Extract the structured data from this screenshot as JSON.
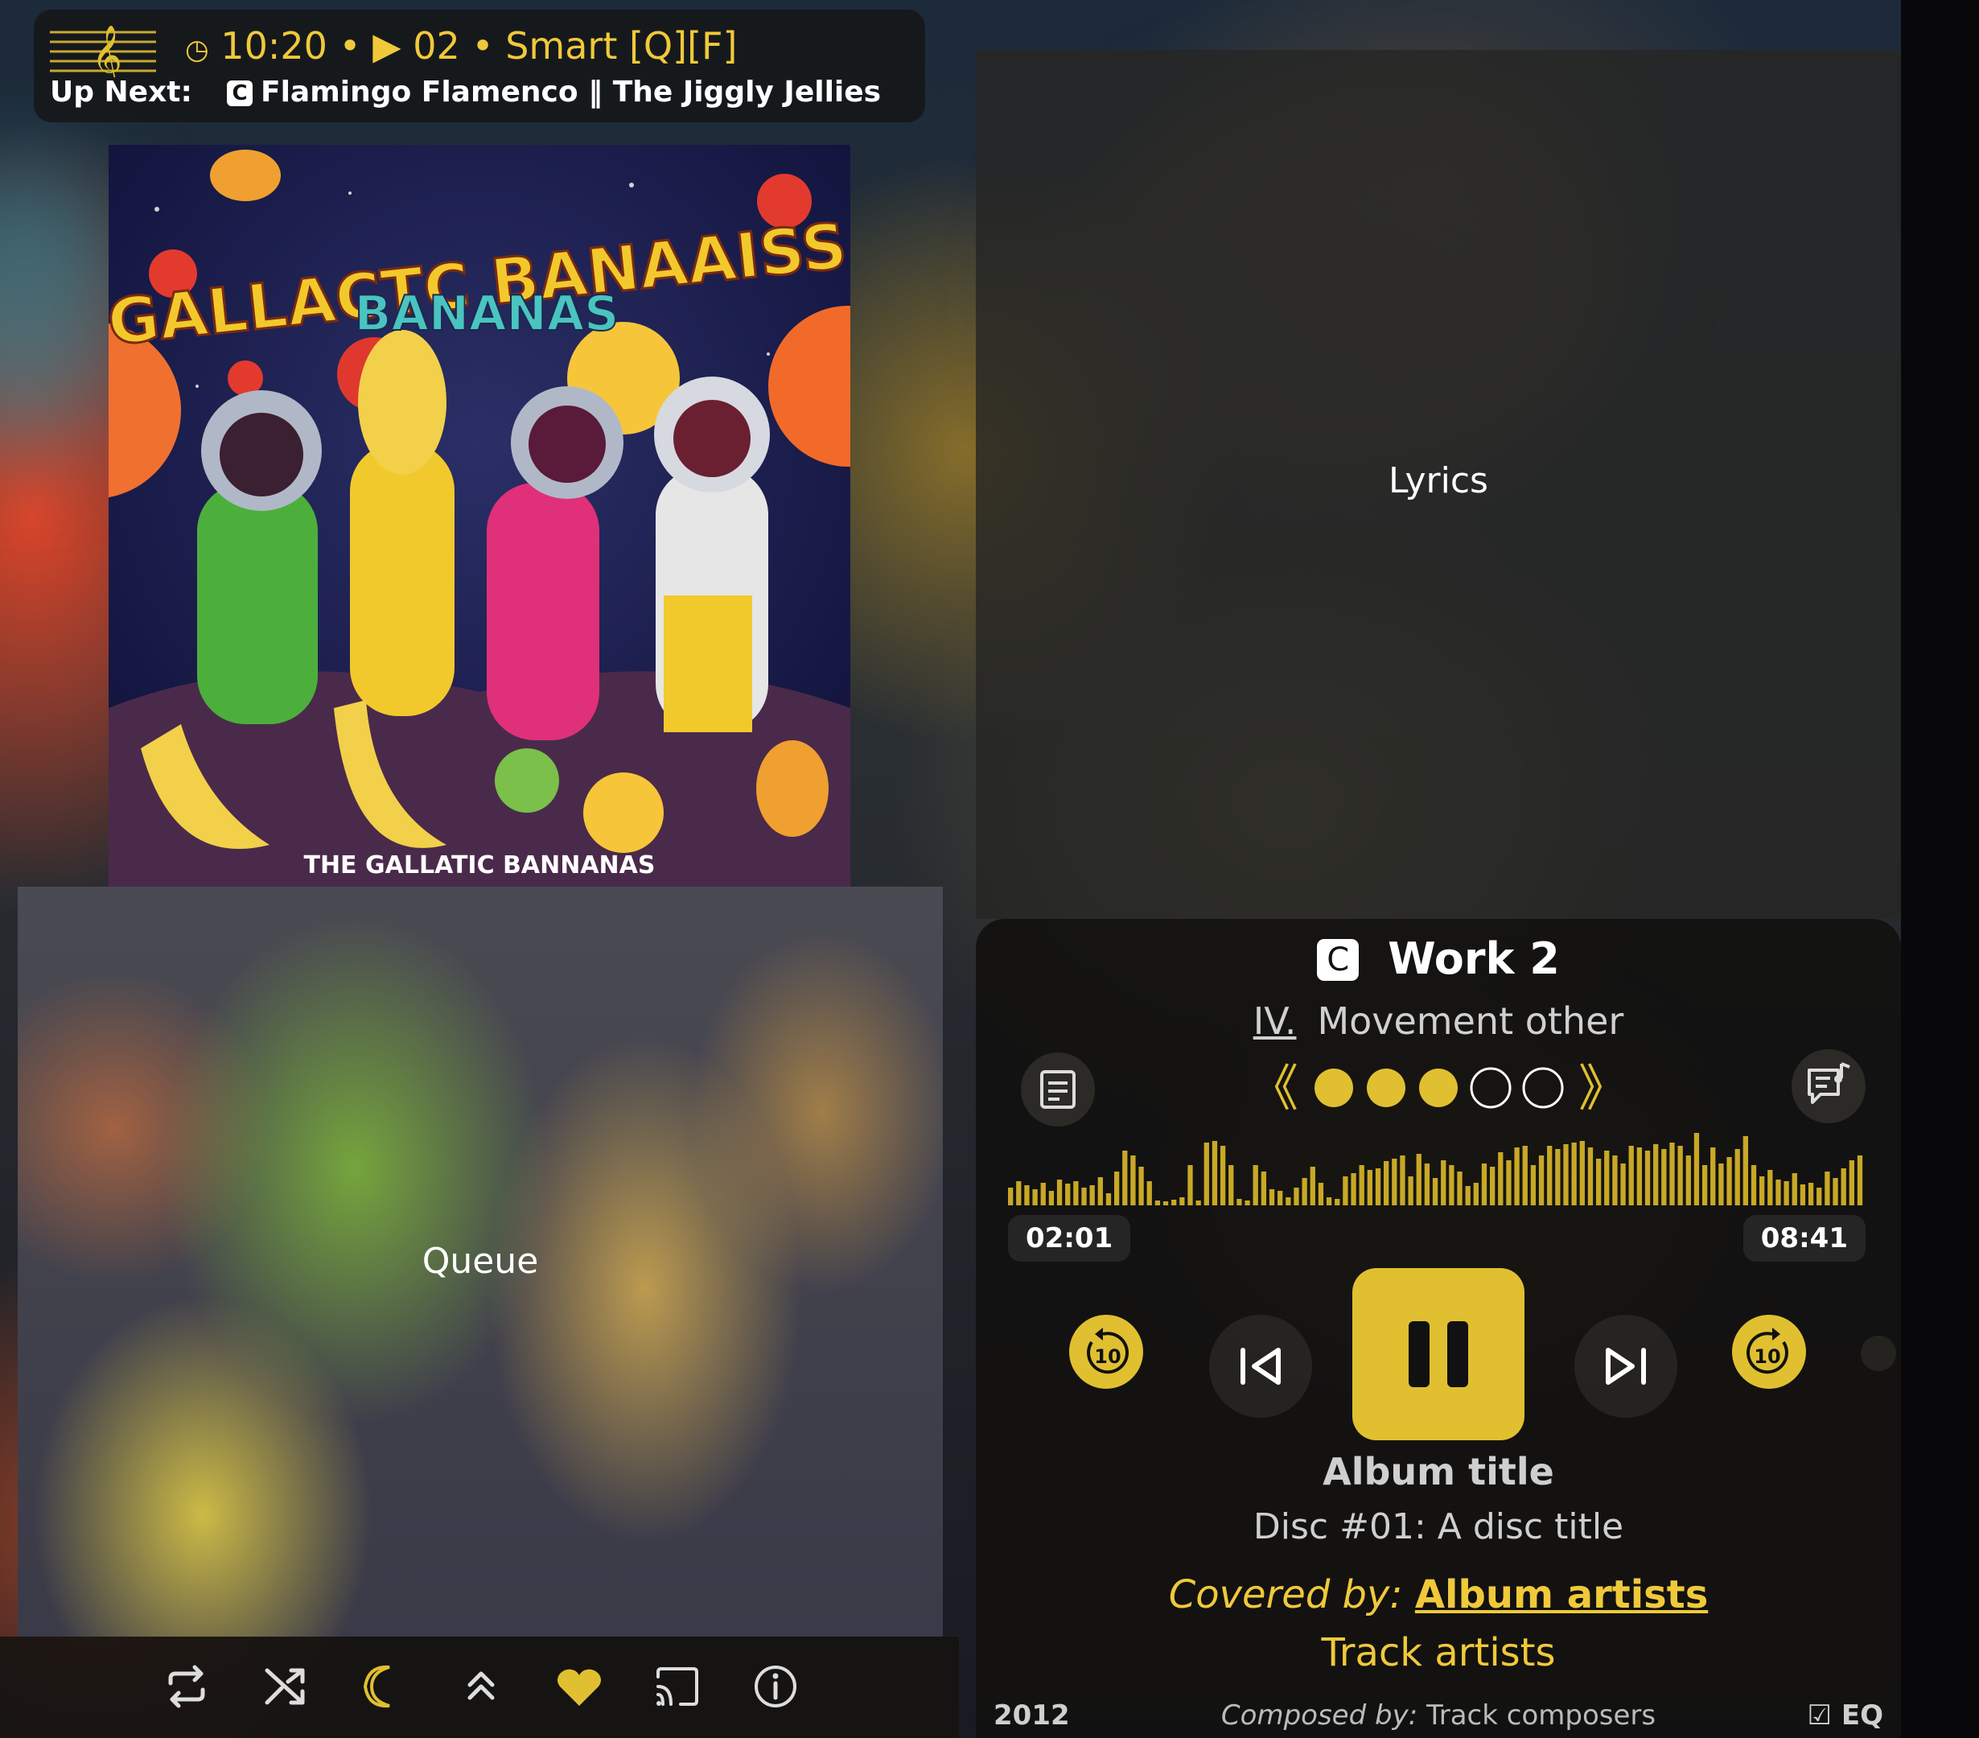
{
  "now_playing": {
    "clock": "10:20",
    "track_number": "02",
    "playlist": "Smart [Q][F]",
    "separator": "•",
    "up_next_label": "Up Next:",
    "up_next_badge": "C",
    "up_next_track": "Flamingo Flamenco",
    "up_next_sep": "‖",
    "up_next_artist": "The Jiggly Jellies"
  },
  "album_art": {
    "title_line1": "GALLACTC BANAAISS",
    "title_line2": "BANANAS",
    "footer": "THE GALLATIC BANNANAS"
  },
  "queue": {
    "label": "Queue"
  },
  "toolbar": {
    "icons": [
      "repeat-icon",
      "shuffle-icon",
      "sleep-timer-icon",
      "expand-up-icon",
      "favorite-heart-icon",
      "cast-icon",
      "info-icon"
    ]
  },
  "lyrics": {
    "label": "Lyrics"
  },
  "player": {
    "badge": "C",
    "work_title": "Work 2",
    "movement_number": "IV.",
    "movement_title": "Movement other",
    "prev_movement": "《",
    "next_movement": "》",
    "movements_total": 5,
    "movements_filled": 3,
    "waveform": [
      0.22,
      0.3,
      0.25,
      0.2,
      0.28,
      0.18,
      0.32,
      0.27,
      0.3,
      0.22,
      0.25,
      0.35,
      0.15,
      0.42,
      0.68,
      0.62,
      0.48,
      0.3,
      0.06,
      0.05,
      0.07,
      0.1,
      0.5,
      0.06,
      0.78,
      0.8,
      0.74,
      0.5,
      0.08,
      0.06,
      0.5,
      0.42,
      0.2,
      0.18,
      0.1,
      0.22,
      0.34,
      0.48,
      0.28,
      0.1,
      0.08,
      0.36,
      0.4,
      0.5,
      0.44,
      0.46,
      0.55,
      0.58,
      0.62,
      0.36,
      0.64,
      0.52,
      0.34,
      0.56,
      0.5,
      0.42,
      0.24,
      0.28,
      0.52,
      0.48,
      0.66,
      0.56,
      0.72,
      0.74,
      0.5,
      0.62,
      0.74,
      0.7,
      0.76,
      0.78,
      0.8,
      0.72,
      0.58,
      0.68,
      0.62,
      0.52,
      0.74,
      0.72,
      0.68,
      0.76,
      0.7,
      0.78,
      0.74,
      0.62,
      0.9,
      0.5,
      0.72,
      0.52,
      0.6,
      0.7,
      0.86,
      0.5,
      0.36,
      0.44,
      0.32,
      0.3,
      0.4,
      0.26,
      0.28,
      0.22,
      0.42,
      0.34,
      0.46,
      0.56,
      0.62
    ],
    "elapsed": "02:01",
    "duration": "08:41",
    "rewind_seconds": "10",
    "forward_seconds": "10",
    "album_title": "Album title",
    "disc_info": "Disc #01: A disc title",
    "covered_by_label": "Covered by:",
    "album_artists": "Album artists",
    "track_artists": "Track artists",
    "year": "2012",
    "composed_by_label": "Composed by:",
    "composers": "Track composers",
    "eq": "☑ EQ"
  },
  "colors": {
    "accent": "#e0c030",
    "accent_text": "#f0c93a",
    "panel": "#121110"
  }
}
